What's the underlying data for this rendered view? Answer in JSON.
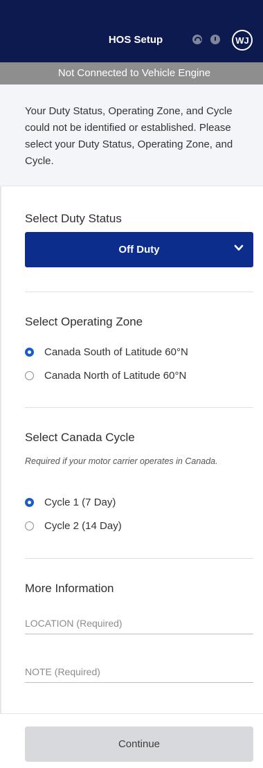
{
  "header": {
    "title": "HOS Setup",
    "icons": [
      "gauge-icon",
      "alert-icon"
    ],
    "avatar_initials": "WJ",
    "background": "#0c1a4f"
  },
  "connection_banner": {
    "text": "Not Connected to Vehicle Engine"
  },
  "notice": {
    "text": "Your Duty Status, Operating Zone, and Cycle could not be identified or established. Please select your Duty Status, Operating Zone, and Cycle."
  },
  "duty_status": {
    "title": "Select Duty Status",
    "selected": "Off Duty",
    "accent": "#0c2d8c"
  },
  "operating_zone": {
    "title": "Select Operating Zone",
    "options": [
      {
        "label": "Canada South of Latitude 60°N",
        "selected": true
      },
      {
        "label": "Canada North of Latitude 60°N",
        "selected": false
      }
    ]
  },
  "canada_cycle": {
    "title": "Select Canada Cycle",
    "hint": "Required if your motor carrier operates in Canada.",
    "options": [
      {
        "label": "Cycle 1 (7 Day)",
        "selected": true
      },
      {
        "label": "Cycle 2 (14 Day)",
        "selected": false
      }
    ]
  },
  "more_info": {
    "title": "More Information",
    "location_placeholder": "LOCATION (Required)",
    "note_placeholder": "NOTE (Required)"
  },
  "footer": {
    "continue_label": "Continue"
  }
}
